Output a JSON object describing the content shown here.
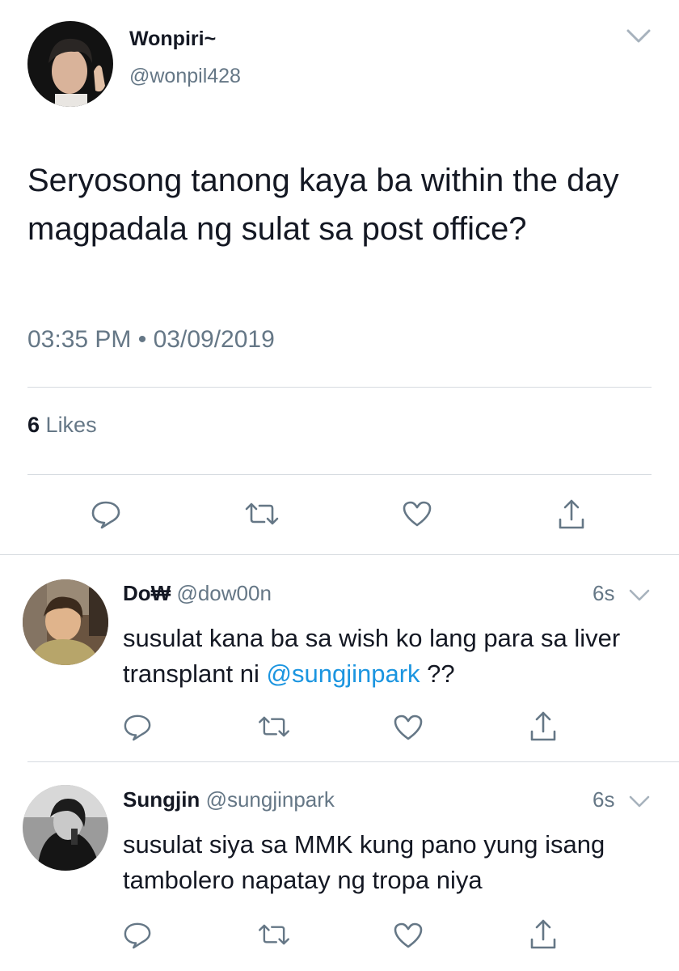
{
  "main_tweet": {
    "display_name": "Wonpiri~",
    "handle": "@wonpil428",
    "text": "Seryosong tanong kaya ba within the day magpadala ng sulat sa post office?",
    "time": "03:35 PM",
    "dot": "•",
    "date": "03/09/2019",
    "likes_count": "6",
    "likes_label": "Likes"
  },
  "replies": [
    {
      "display_name": "Do₩",
      "handle": "@dow00n",
      "age": "6s",
      "text_before": "susulat kana ba sa wish ko lang para sa liver transplant ni ",
      "mention": "@sungjinpark",
      "text_after": " ??"
    },
    {
      "display_name": "Sungjin",
      "handle": "@sungjinpark",
      "age": "6s",
      "text": "susulat siya sa MMK kung pano yung isang tambolero napatay ng tropa niya"
    }
  ],
  "colors": {
    "text": "#141823",
    "secondary": "#657786",
    "link": "#1b95e0",
    "divider": "#d6dbe0"
  },
  "icons": [
    "chevron-down-icon",
    "reply-icon",
    "retweet-icon",
    "like-icon",
    "share-icon"
  ]
}
